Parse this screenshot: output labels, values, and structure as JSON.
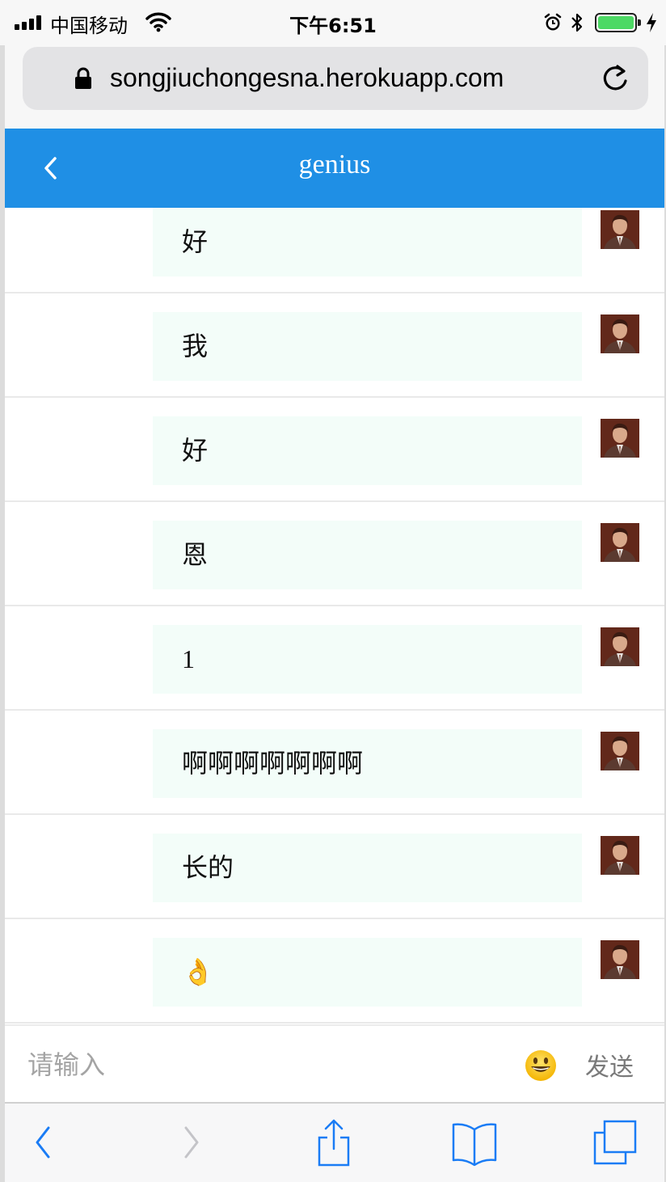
{
  "status_bar": {
    "carrier": "中国移动",
    "time": "下午6:51",
    "icons": [
      "signal-icon",
      "wifi-icon",
      "alarm-icon",
      "bluetooth-icon",
      "battery-icon",
      "charging-icon"
    ],
    "battery_color": "#4cd964"
  },
  "browser": {
    "url": "songjiuchongesna.herokuapp.com",
    "icons": [
      "lock-icon",
      "reload-icon"
    ]
  },
  "header": {
    "title": "genius",
    "background": "#1f8fe5"
  },
  "messages": [
    {
      "text": "好"
    },
    {
      "text": "我"
    },
    {
      "text": "好"
    },
    {
      "text": "恩"
    },
    {
      "text": "1"
    },
    {
      "text": "啊啊啊啊啊啊啊"
    },
    {
      "text": "长的"
    },
    {
      "text": "👌"
    }
  ],
  "input_bar": {
    "placeholder": "请输入",
    "send_label": "发送",
    "emoji_icon": "😀"
  },
  "toolbar": {
    "icons": [
      "back-icon",
      "forward-icon",
      "share-icon",
      "bookmarks-icon",
      "tabs-icon"
    ],
    "accent": "#1a7cf5"
  }
}
